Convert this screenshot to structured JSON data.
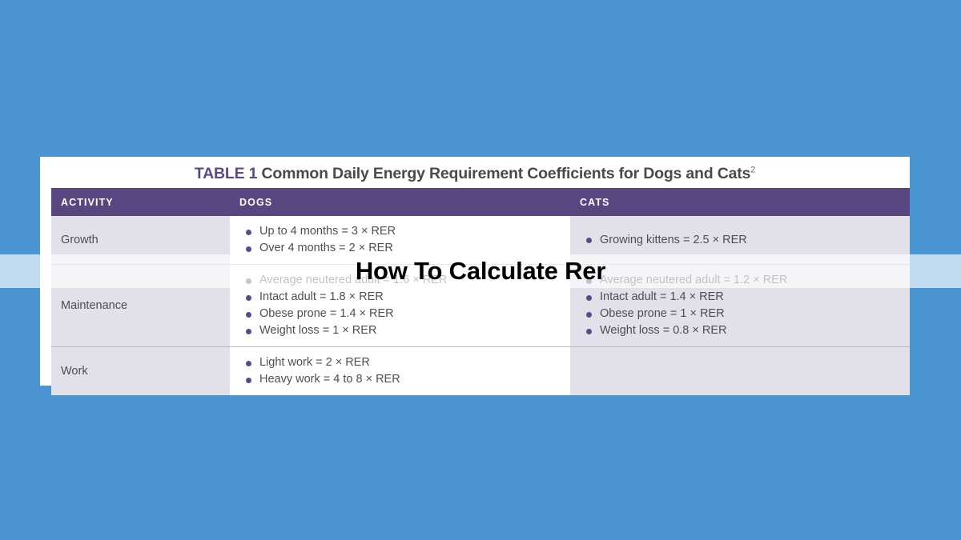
{
  "page": {
    "background_color": "#4a95d2",
    "card_background": "#ffffff"
  },
  "table": {
    "title_prefix": "TABLE 1",
    "title_text": " Common Daily Energy Requirement Coefficients for Dogs and Cats",
    "title_superscript": "2",
    "header_color": "#584681",
    "accent_color": "#5b4a8a",
    "columns": [
      {
        "label": "ACTIVITY"
      },
      {
        "label": "DOGS"
      },
      {
        "label": "CATS"
      }
    ],
    "rows": [
      {
        "activity": "Growth",
        "dogs": [
          "Up to 4 months = 3 × RER",
          "Over 4 months = 2 × RER"
        ],
        "cats": [
          "Growing kittens = 2.5 × RER"
        ]
      },
      {
        "activity": "Maintenance",
        "dogs": [
          "Average neutered adult = 1.6 × RER",
          "Intact adult = 1.8 × RER",
          "Obese prone = 1.4 × RER",
          "Weight loss = 1 × RER"
        ],
        "cats": [
          "Average neutered adult = 1.2 × RER",
          "Intact adult = 1.4 × RER",
          "Obese prone = 1 × RER",
          "Weight loss = 0.8 × RER"
        ]
      },
      {
        "activity": "Work",
        "dogs": [
          "Light work = 2 × RER",
          "Heavy work = 4 to 8 × RER"
        ],
        "cats": []
      }
    ]
  },
  "overlay": {
    "title": "How To Calculate Rer",
    "text_color": "#000000"
  }
}
